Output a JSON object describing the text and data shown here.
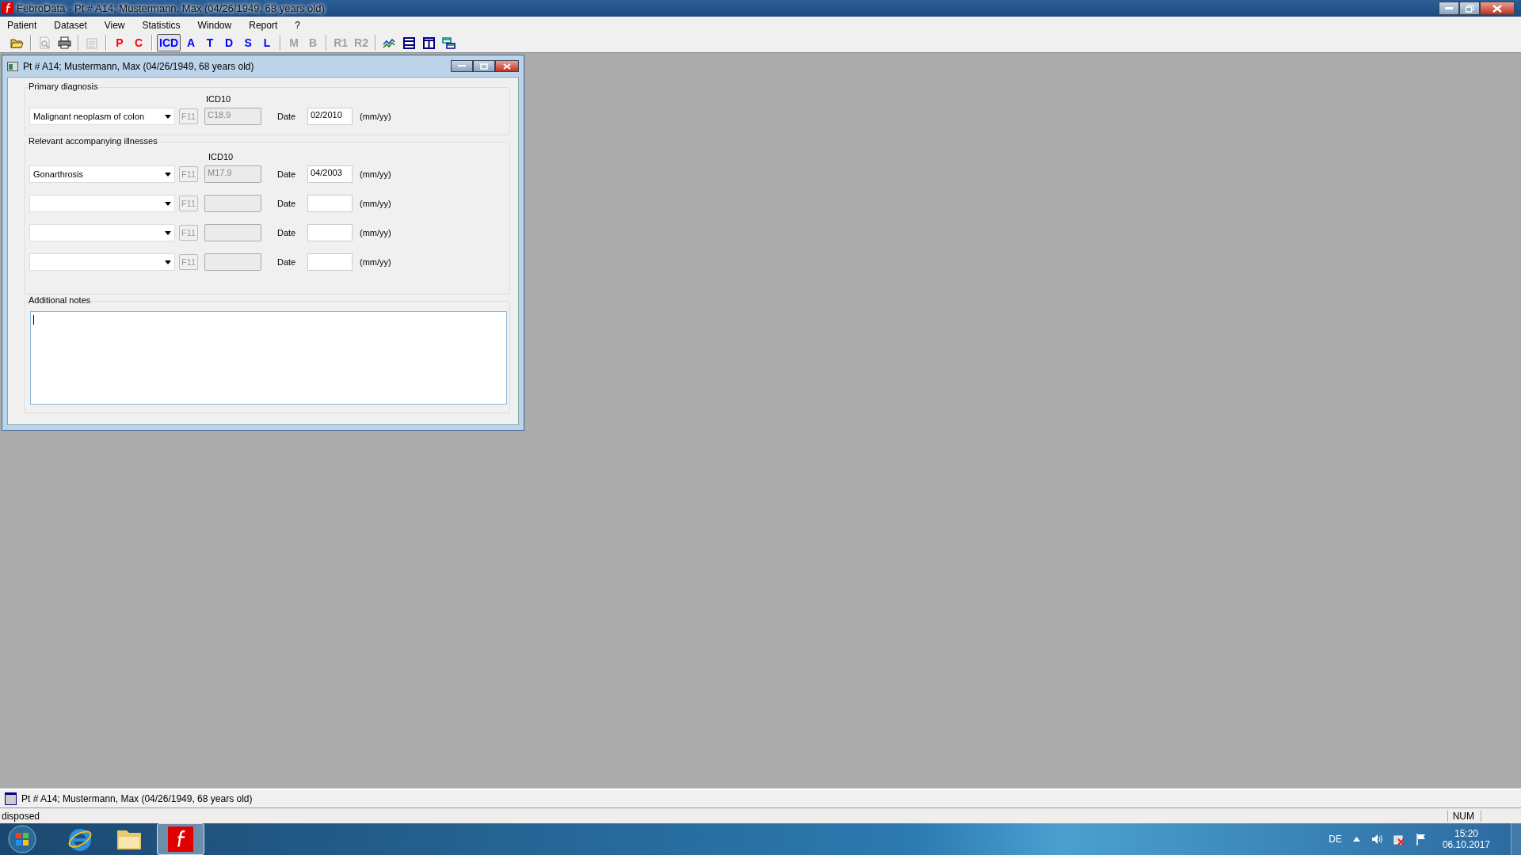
{
  "app_window": {
    "title": "FebroData - Pt # A14; Mustermann, Max (04/26/1949, 68 years old)"
  },
  "menu": [
    "Patient",
    "Dataset",
    "View",
    "Statistics",
    "Window",
    "Report",
    "?"
  ],
  "toolbar": [
    {
      "kind": "icon",
      "disabled": false
    },
    {
      "kind": "separator"
    },
    {
      "kind": "icon",
      "disabled": true
    },
    {
      "kind": "icon",
      "disabled": false
    },
    {
      "kind": "separator"
    },
    {
      "kind": "icon",
      "disabled": true
    },
    {
      "kind": "separator"
    },
    {
      "kind": "letter",
      "label": "P",
      "color": "#ff0000",
      "disabled": false,
      "selected": false
    },
    {
      "kind": "letter",
      "label": "C",
      "color": "#ff0000",
      "disabled": false,
      "selected": false
    },
    {
      "kind": "separator"
    },
    {
      "kind": "letter",
      "label": "ICD",
      "color": "#0000ff",
      "disabled": false,
      "selected": true
    },
    {
      "kind": "letter",
      "label": "A",
      "color": "#0000ff",
      "disabled": false,
      "selected": false
    },
    {
      "kind": "letter",
      "label": "T",
      "color": "#0000ff",
      "disabled": false,
      "selected": false
    },
    {
      "kind": "letter",
      "label": "D",
      "color": "#0000ff",
      "disabled": false,
      "selected": false
    },
    {
      "kind": "letter",
      "label": "S",
      "color": "#0000ff",
      "disabled": false,
      "selected": false
    },
    {
      "kind": "letter",
      "label": "L",
      "color": "#0000ff",
      "disabled": false,
      "selected": false
    },
    {
      "kind": "separator"
    },
    {
      "kind": "letter",
      "label": "M",
      "disabled": true,
      "selected": false
    },
    {
      "kind": "letter",
      "label": "B",
      "disabled": true,
      "selected": false
    },
    {
      "kind": "separator"
    },
    {
      "kind": "letter",
      "label": "R1",
      "disabled": true,
      "selected": false
    },
    {
      "kind": "letter",
      "label": "R2",
      "disabled": true,
      "selected": false
    },
    {
      "kind": "separator"
    },
    {
      "kind": "icon",
      "disabled": false
    },
    {
      "kind": "icon",
      "disabled": false
    },
    {
      "kind": "icon",
      "disabled": false
    },
    {
      "kind": "icon",
      "disabled": false
    }
  ],
  "child_window": {
    "title": "Pt # A14; Mustermann, Max (04/26/1949, 68 years old)",
    "primary_diagnosis": {
      "label": "Primary diagnosis",
      "icd_label": "ICD10",
      "row": {
        "diagnosis": "Malignant neoplasm of colon",
        "f11": "F11",
        "icd_code": "C18.9",
        "date_label": "Date",
        "date": "02/2010",
        "date_hint": "(mm/yy)"
      }
    },
    "accompanying": {
      "label": "Relevant accompanying illnesses",
      "icd_label": "ICD10",
      "rows": [
        {
          "diagnosis": "Gonarthrosis",
          "f11": "F11",
          "icd_code": "M17.9",
          "date_label": "Date",
          "date": "04/2003",
          "date_hint": "(mm/yy)"
        },
        {
          "f11": "F11",
          "date_label": "Date",
          "date_hint": "(mm/yy)"
        },
        {
          "f11": "F11",
          "date_label": "Date",
          "date_hint": "(mm/yy)"
        },
        {
          "f11": "F11",
          "date_label": "Date",
          "date_hint": "(mm/yy)"
        }
      ]
    },
    "notes": {
      "label": "Additional notes"
    }
  },
  "window_list": [
    {
      "title": "Pt # A14; Mustermann, Max (04/26/1949, 68 years old)"
    }
  ],
  "status_bar": {
    "message": "disposed",
    "num": "NUM"
  },
  "taskbar": {
    "language": "DE",
    "time": "15:20",
    "date": "06.10.2017"
  }
}
